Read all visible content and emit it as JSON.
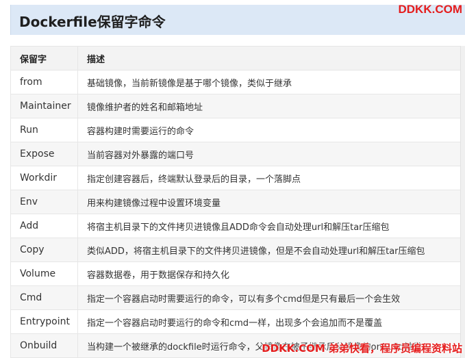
{
  "heading": "Dockerfile保留字命令",
  "watermark_top": "DDKK.COM",
  "watermark_bottom": "DDKK.COM 弟弟快看，程序员编程资料站",
  "colors": {
    "title_bg": "#dce8f6",
    "watermark": "#e51c1c",
    "header_bg": "#f3f3f3",
    "stripe_bg": "#f6f6f6"
  },
  "table": {
    "headers": [
      "保留字",
      "描述"
    ],
    "rows": [
      {
        "key": "from",
        "desc": "基础镜像，当前新镜像是基于哪个镜像，类似于继承"
      },
      {
        "key": "Maintainer",
        "desc": "镜像维护者的姓名和邮箱地址"
      },
      {
        "key": "Run",
        "desc": "容器构建时需要运行的命令"
      },
      {
        "key": "Expose",
        "desc": "当前容器对外暴露的端口号"
      },
      {
        "key": "Workdir",
        "desc": "指定创建容器后，终端默认登录后的目录，一个落脚点"
      },
      {
        "key": "Env",
        "desc": "用来构建镜像过程中设置环境变量"
      },
      {
        "key": "Add",
        "desc": "将宿主机目录下的文件拷贝进镜像且ADD命令会自动处理url和解压tar压缩包"
      },
      {
        "key": "Copy",
        "desc": "类似ADD，将宿主机目录下的文件拷贝进镜像，但是不会自动处理url和解压tar压缩包"
      },
      {
        "key": "Volume",
        "desc": "容器数据卷，用于数据保存和持久化"
      },
      {
        "key": "Cmd",
        "desc": "指定一个容器启动时需要运行的命令，可以有多个cmd但是只有最后一个会生效"
      },
      {
        "key": "Entrypoint",
        "desc": "指定一个容器启动时要运行的命令和cmd一样，出现多个会追加而不是覆盖"
      },
      {
        "key": "Onbuild",
        "desc": "当构建一个被继承的dockfile时运行命令，父镜像在被子继承后父镜像的onbuild触发"
      }
    ]
  }
}
